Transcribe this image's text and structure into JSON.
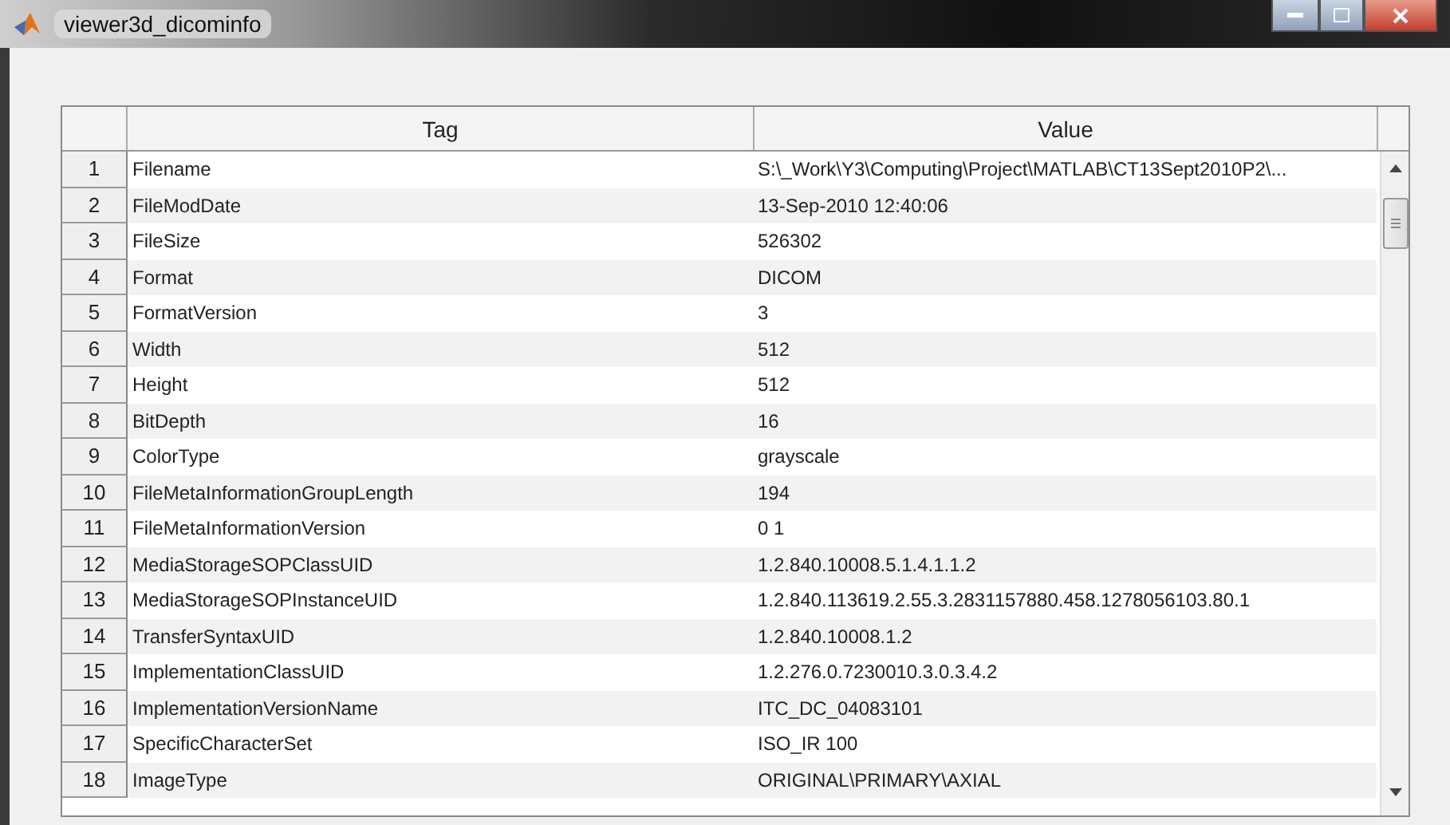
{
  "window": {
    "title": "viewer3d_dicominfo"
  },
  "table": {
    "columns": [
      "Tag",
      "Value"
    ],
    "rows": [
      {
        "number": "1",
        "tag": "Filename",
        "value": "S:\\_Work\\Y3\\Computing\\Project\\MATLAB\\CT13Sept2010P2\\..."
      },
      {
        "number": "2",
        "tag": "FileModDate",
        "value": "13-Sep-2010 12:40:06"
      },
      {
        "number": "3",
        "tag": "FileSize",
        "value": "526302"
      },
      {
        "number": "4",
        "tag": "Format",
        "value": "DICOM"
      },
      {
        "number": "5",
        "tag": "FormatVersion",
        "value": "3"
      },
      {
        "number": "6",
        "tag": "Width",
        "value": "512"
      },
      {
        "number": "7",
        "tag": "Height",
        "value": "512"
      },
      {
        "number": "8",
        "tag": "BitDepth",
        "value": "16"
      },
      {
        "number": "9",
        "tag": "ColorType",
        "value": "grayscale"
      },
      {
        "number": "10",
        "tag": "FileMetaInformationGroupLength",
        "value": "194"
      },
      {
        "number": "11",
        "tag": "FileMetaInformationVersion",
        "value": "0  1"
      },
      {
        "number": "12",
        "tag": "MediaStorageSOPClassUID",
        "value": "1.2.840.10008.5.1.4.1.1.2"
      },
      {
        "number": "13",
        "tag": "MediaStorageSOPInstanceUID",
        "value": "1.2.840.113619.2.55.3.2831157880.458.1278056103.80.1"
      },
      {
        "number": "14",
        "tag": "TransferSyntaxUID",
        "value": "1.2.840.10008.1.2"
      },
      {
        "number": "15",
        "tag": "ImplementationClassUID",
        "value": "1.2.276.0.7230010.3.0.3.4.2"
      },
      {
        "number": "16",
        "tag": "ImplementationVersionName",
        "value": "ITC_DC_04083101"
      },
      {
        "number": "17",
        "tag": "SpecificCharacterSet",
        "value": "ISO_IR 100"
      },
      {
        "number": "18",
        "tag": "ImageType",
        "value": "ORIGINAL\\PRIMARY\\AXIAL"
      }
    ]
  }
}
